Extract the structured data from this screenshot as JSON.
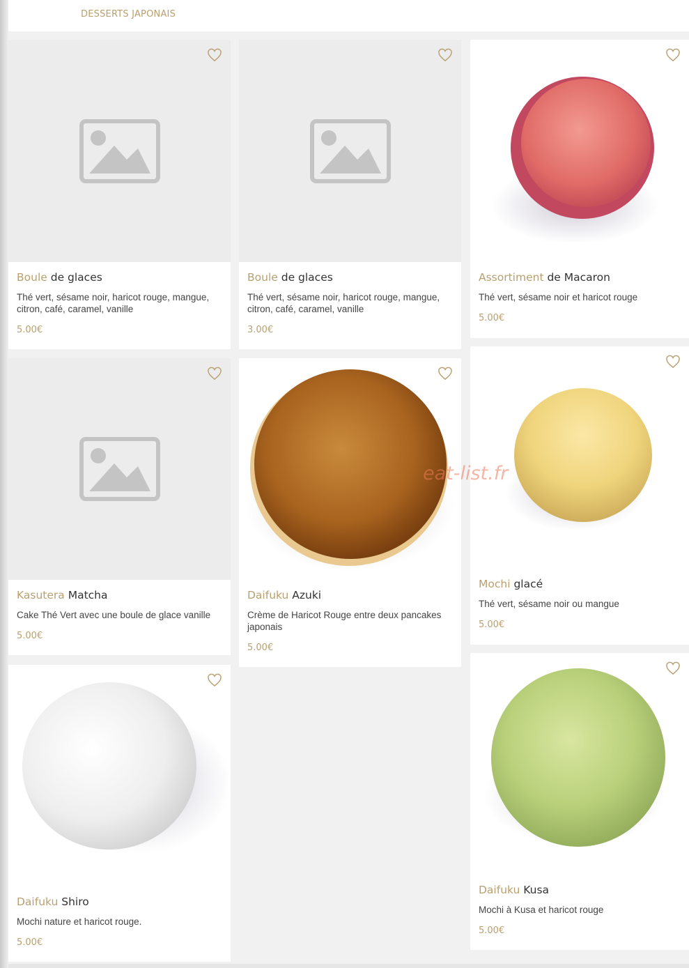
{
  "section": {
    "title": "DESSERTS JAPONAIS"
  },
  "watermark": "eat-list.fr",
  "colors": {
    "accent": "#b8a070",
    "background": "#f1f1f1",
    "card": "#ffffff"
  },
  "icons": {
    "favorite": "heart-outline-icon",
    "placeholder": "image-placeholder-icon"
  },
  "products": [
    {
      "name_first": "Boule",
      "name_rest": " de glaces",
      "description": "Thé vert, sésame noir, haricot rouge, mangue, citron, café, caramel, vanille",
      "price": "5.00€"
    },
    {
      "name_first": "Boule",
      "name_rest": " de glaces",
      "description": "Thé vert, sésame noir, haricot rouge, mangue, citron, café, caramel, vanille",
      "price": "3.00€"
    },
    {
      "name_first": "Assortiment",
      "name_rest": " de Macaron",
      "description": "Thé vert, sésame noir et haricot rouge",
      "price": "5.00€"
    },
    {
      "name_first": "Kasutera",
      "name_rest": " Matcha",
      "description": "Cake Thé Vert avec une boule de glace vanille",
      "price": "5.00€"
    },
    {
      "name_first": "Daifuku",
      "name_rest": " Azuki",
      "description": "Crème de Haricot Rouge entre deux pancakes japonais",
      "price": "5.00€"
    },
    {
      "name_first": "Mochi",
      "name_rest": " glacé",
      "description": "Thé vert, sésame noir ou mangue",
      "price": "5.00€"
    },
    {
      "name_first": "Daifuku",
      "name_rest": " Shiro",
      "description": "Mochi nature et haricot rouge.",
      "price": "5.00€"
    },
    {
      "name_first": "Daifuku",
      "name_rest": " Kusa",
      "description": "Mochi à Kusa et haricot rouge",
      "price": "5.00€"
    }
  ]
}
